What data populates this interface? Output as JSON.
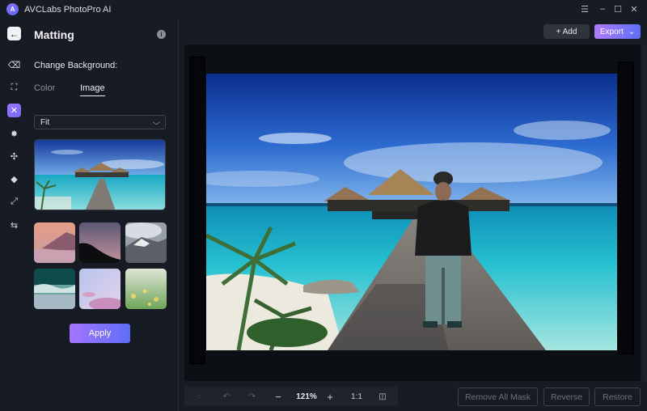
{
  "app": {
    "title": "AVCLabs PhotoPro AI",
    "logo_glyph": "A",
    "window_controls": [
      {
        "name": "menu",
        "glyph": "☰"
      },
      {
        "name": "minimize",
        "glyph": "–"
      },
      {
        "name": "maximize",
        "glyph": "☐"
      },
      {
        "name": "close",
        "glyph": "✕"
      }
    ]
  },
  "rail": {
    "back_glyph": "←",
    "items": [
      {
        "name": "eraser",
        "glyph": "⌫",
        "active": false
      },
      {
        "name": "object-select",
        "glyph": "⛶",
        "active": false
      },
      {
        "name": "matting",
        "glyph": "✕",
        "active": true
      },
      {
        "name": "enhance",
        "glyph": "✸",
        "active": false
      },
      {
        "name": "colorize",
        "glyph": "✣",
        "active": false
      },
      {
        "name": "fill",
        "glyph": "◆",
        "active": false
      },
      {
        "name": "resize",
        "glyph": "⤢",
        "active": false
      },
      {
        "name": "adjust",
        "glyph": "⇆",
        "active": false
      }
    ]
  },
  "panel": {
    "title": "Matting",
    "info_glyph": "i",
    "section_label": "Change Background:",
    "tabs": [
      {
        "label": "Color",
        "active": false
      },
      {
        "label": "Image",
        "active": true
      }
    ],
    "fit_select": {
      "value": "Fit",
      "chevron": "⌄"
    },
    "preview_alt": "Beach pier with overwater huts",
    "thumbnails": [
      {
        "name": "pink-mountain"
      },
      {
        "name": "dusk-treeline"
      },
      {
        "name": "snowy-mountain"
      },
      {
        "name": "ocean-waves"
      },
      {
        "name": "pastel-clouds"
      },
      {
        "name": "flower-meadow"
      }
    ],
    "apply_label": "Apply"
  },
  "toolbar": {
    "add_label": "+ Add",
    "export_label": "Export",
    "export_chevron": "⌄"
  },
  "zoombar": {
    "reset_glyph": "◌",
    "undo_glyph": "↶",
    "redo_glyph": "↷",
    "zoom_out_glyph": "−",
    "zoom_level": "121%",
    "zoom_in_glyph": "+",
    "actual_size_label": "1:1",
    "compare_glyph": "◫"
  },
  "actions": {
    "remove_all_mask": "Remove All Mask",
    "reverse": "Reverse",
    "restore": "Restore"
  }
}
